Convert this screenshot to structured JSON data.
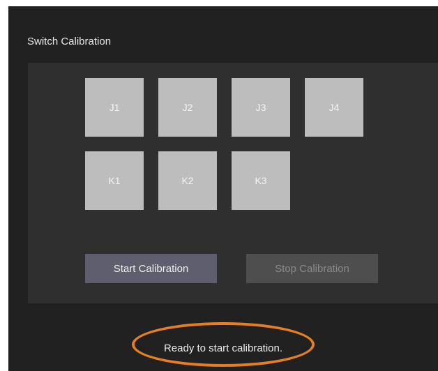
{
  "window": {
    "title": "Switch Calibration"
  },
  "switches": {
    "row1": [
      "J1",
      "J2",
      "J3",
      "J4"
    ],
    "row2": [
      "K1",
      "K2",
      "K3"
    ]
  },
  "buttons": {
    "start_label": "Start Calibration",
    "stop_label": "Stop Calibration",
    "stop_enabled": false
  },
  "status": {
    "message": "Ready to start calibration."
  },
  "colors": {
    "window_bg": "#212121",
    "panel_bg": "#2f2f2f",
    "tile_bg": "#bdbdbd",
    "start_button_bg": "#5e5e6e",
    "stop_button_bg": "#4e4e4e",
    "annotation_outline": "#e67e22"
  }
}
